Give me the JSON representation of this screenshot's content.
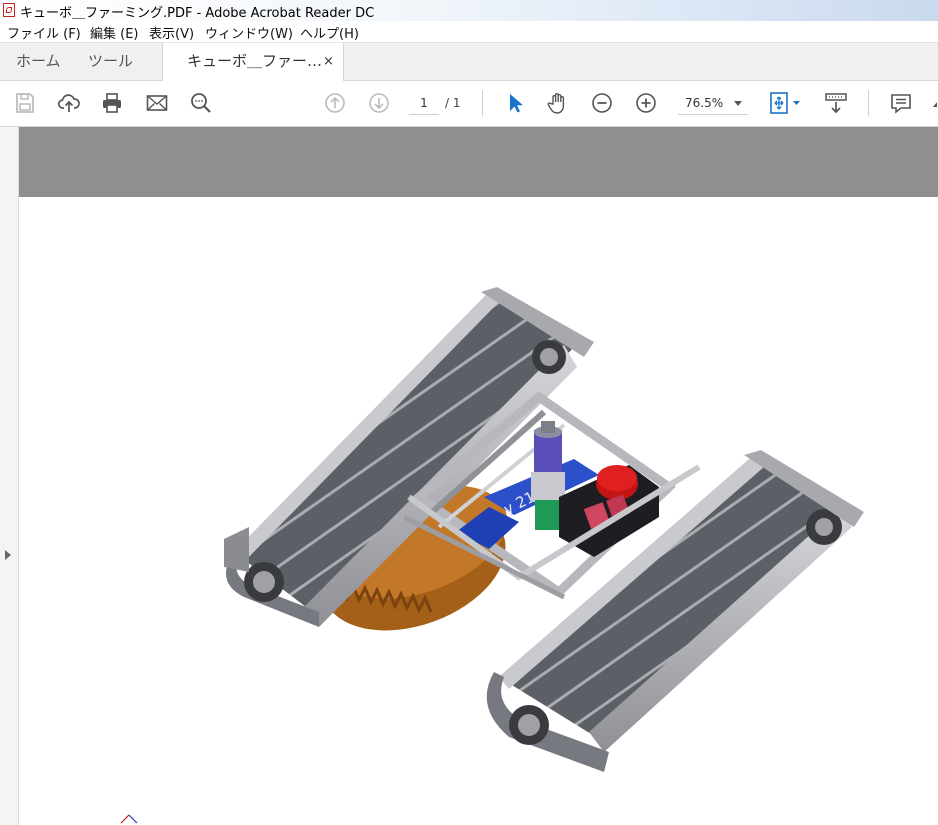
{
  "window": {
    "title": "キューボ＿ファーミング.PDF - Adobe Acrobat Reader DC"
  },
  "menu": [
    "ファイル (F)",
    "編集 (E)",
    "表示(V)",
    "ウィンドウ(W)",
    "ヘルプ(H)"
  ],
  "tabs": {
    "home": "ホーム",
    "tools": "ツール",
    "document": "キューボ＿ファー…",
    "close_glyph": "×"
  },
  "toolbar": {
    "page_current": "1",
    "page_total": "/ 1",
    "zoom": "76.5%",
    "icons": [
      "save-icon",
      "cloud-upload-icon",
      "print-icon",
      "email-icon",
      "search-icon",
      "prev-page-icon",
      "next-page-icon",
      "select-cursor-icon",
      "hand-icon",
      "zoom-out-icon",
      "zoom-in-icon",
      "fit-page-icon",
      "scroll-mode-icon",
      "comment-icon"
    ]
  },
  "document": {
    "model_label": "y 21"
  },
  "colors": {
    "accent_blue": "#1a73c9",
    "doc_gray": "#8f8f8f",
    "track_gray": "#5a5c63",
    "base_orange": "#a45f18",
    "estop_red": "#c41414",
    "battery_blue": "#1f3fb5"
  }
}
